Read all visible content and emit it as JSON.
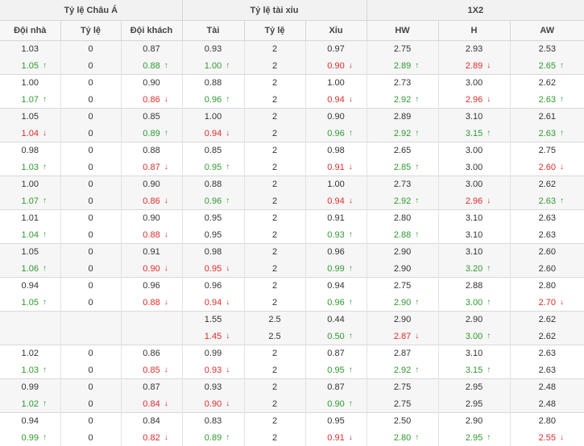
{
  "groups": [
    "Tỷ lệ Châu Á",
    "Tỷ lệ tài xỉu",
    "1X2"
  ],
  "columns": [
    "Đội nhà",
    "Tỷ lệ",
    "Đội khách",
    "Tài",
    "Tỷ lệ",
    "Xỉu",
    "HW",
    "H",
    "AW"
  ],
  "arrows": {
    "up": "↑",
    "down": "↓"
  },
  "colors": {
    "up": "#2e9a2e",
    "down": "#e02b2b"
  },
  "rows": [
    [
      [
        "1.03",
        "0",
        "0.87",
        "0.93",
        "2",
        "0.97",
        "2.75",
        "2.93",
        "2.53"
      ],
      [
        "1.05u",
        "0",
        "0.88u",
        "1.00u",
        "2",
        "0.90d",
        "2.89u",
        "2.89d",
        "2.65u"
      ]
    ],
    [
      [
        "1.00",
        "0",
        "0.90",
        "0.88",
        "2",
        "1.00",
        "2.73",
        "3.00",
        "2.62"
      ],
      [
        "1.07u",
        "0",
        "0.86d",
        "0.96u",
        "2",
        "0.94d",
        "2.92u",
        "2.96d",
        "2.63u"
      ]
    ],
    [
      [
        "1.05",
        "0",
        "0.85",
        "1.00",
        "2",
        "0.90",
        "2.89",
        "3.10",
        "2.61"
      ],
      [
        "1.04d",
        "0",
        "0.89u",
        "0.94d",
        "2",
        "0.96u",
        "2.92u",
        "3.15u",
        "2.63u"
      ]
    ],
    [
      [
        "0.98",
        "0",
        "0.88",
        "0.85",
        "2",
        "0.98",
        "2.65",
        "3.00",
        "2.75"
      ],
      [
        "1.03u",
        "0",
        "0.87d",
        "0.95u",
        "2",
        "0.91d",
        "2.85u",
        "3.00",
        "2.60d"
      ]
    ],
    [
      [
        "1.00",
        "0",
        "0.90",
        "0.88",
        "2",
        "1.00",
        "2.73",
        "3.00",
        "2.62"
      ],
      [
        "1.07u",
        "0",
        "0.86d",
        "0.96u",
        "2",
        "0.94d",
        "2.92u",
        "2.96d",
        "2.63u"
      ]
    ],
    [
      [
        "1.01",
        "0",
        "0.90",
        "0.95",
        "2",
        "0.91",
        "2.80",
        "3.10",
        "2.63"
      ],
      [
        "1.04u",
        "0",
        "0.88d",
        "0.95",
        "2",
        "0.93u",
        "2.88u",
        "3.10",
        "2.63"
      ]
    ],
    [
      [
        "1.05",
        "0",
        "0.91",
        "0.98",
        "2",
        "0.96",
        "2.90",
        "3.10",
        "2.60"
      ],
      [
        "1.06u",
        "0",
        "0.90d",
        "0.95d",
        "2",
        "0.99u",
        "2.90",
        "3.20u",
        "2.60"
      ]
    ],
    [
      [
        "0.94",
        "0",
        "0.96",
        "0.96",
        "2",
        "0.94",
        "2.75",
        "2.88",
        "2.80"
      ],
      [
        "1.05u",
        "0",
        "0.88d",
        "0.94d",
        "2",
        "0.96u",
        "2.90u",
        "3.00u",
        "2.70d"
      ]
    ],
    [
      [
        "",
        "",
        "",
        "1.55",
        "2.5",
        "0.44",
        "2.90",
        "2.90",
        "2.62"
      ],
      [
        "",
        "",
        "",
        "1.45d",
        "2.5",
        "0.50u",
        "2.87d",
        "3.00u",
        "2.62"
      ]
    ],
    [
      [
        "1.02",
        "0",
        "0.86",
        "0.99",
        "2",
        "0.87",
        "2.87",
        "3.10",
        "2.63"
      ],
      [
        "1.03u",
        "0",
        "0.85d",
        "0.93d",
        "2",
        "0.95u",
        "2.92u",
        "3.15u",
        "2.63"
      ]
    ],
    [
      [
        "0.99",
        "0",
        "0.87",
        "0.93",
        "2",
        "0.87",
        "2.75",
        "2.95",
        "2.48"
      ],
      [
        "1.02u",
        "0",
        "0.84d",
        "0.90d",
        "2",
        "0.90u",
        "2.75",
        "2.95",
        "2.48"
      ]
    ],
    [
      [
        "0.94",
        "0",
        "0.84",
        "0.83",
        "2",
        "0.95",
        "2.50",
        "2.90",
        "2.80"
      ],
      [
        "0.99u",
        "0",
        "0.82d",
        "0.89u",
        "2",
        "0.91d",
        "2.80u",
        "2.95u",
        "2.55d"
      ]
    ]
  ]
}
